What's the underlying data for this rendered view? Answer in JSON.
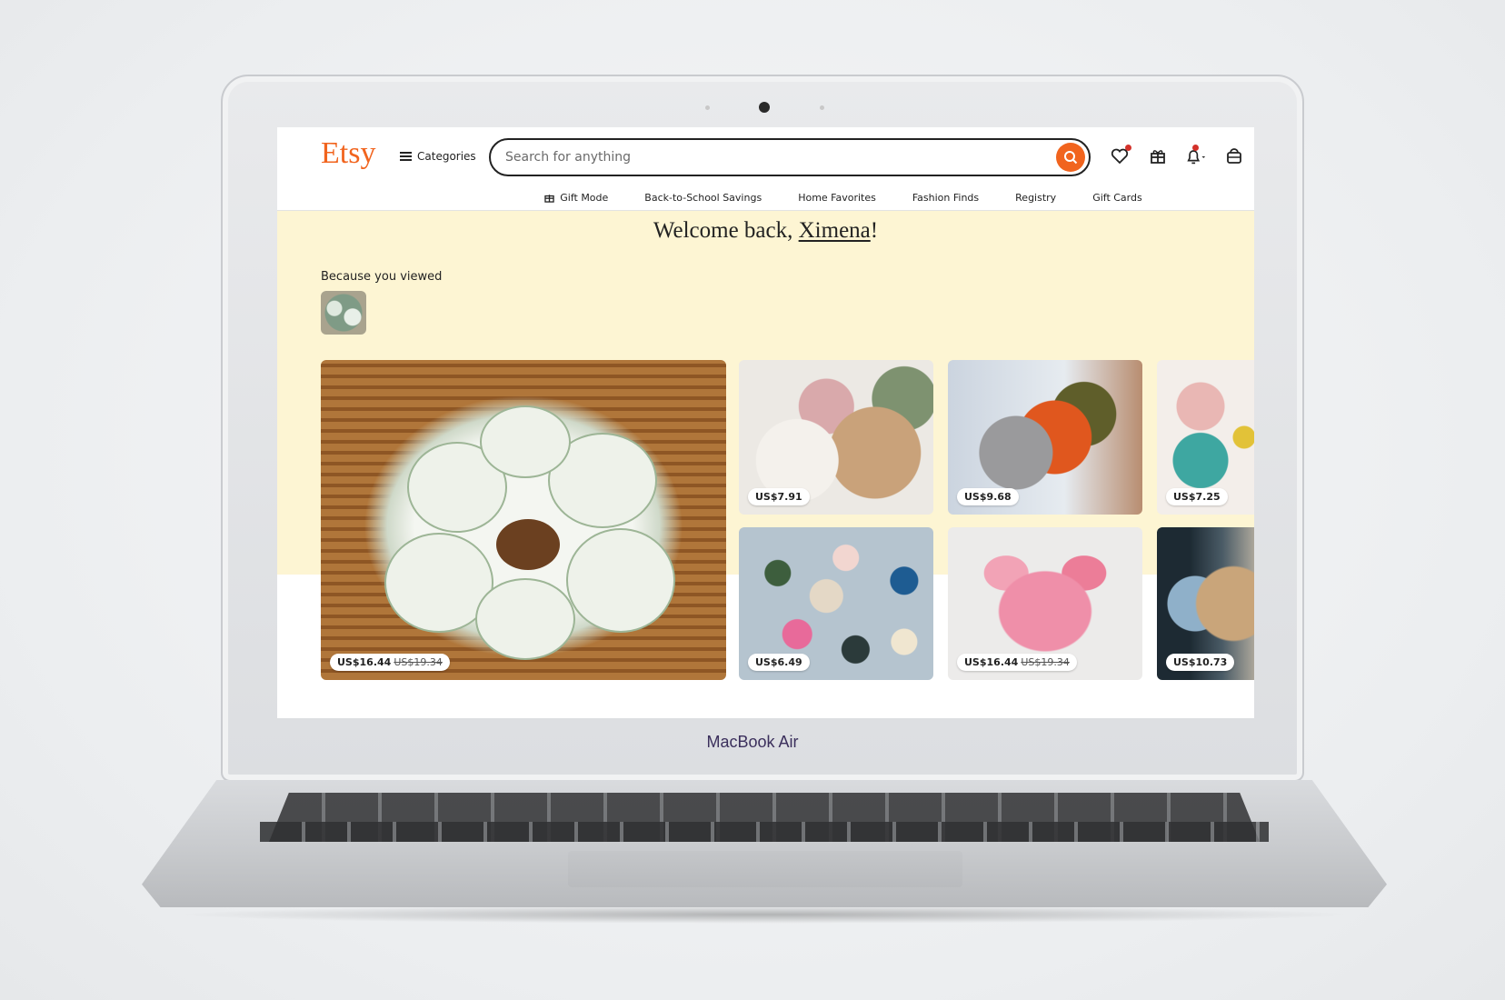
{
  "device": {
    "label": "MacBook Air"
  },
  "header": {
    "logo": "Etsy",
    "categories_label": "Categories",
    "search_placeholder": "Search for anything"
  },
  "subnav": {
    "items": [
      "Gift Mode",
      "Back-to-School Savings",
      "Home Favorites",
      "Fashion Finds",
      "Registry",
      "Gift Cards"
    ]
  },
  "banner": {
    "welcome_prefix": "Welcome back, ",
    "user_name": "Ximena",
    "welcome_suffix": "!",
    "because_viewed": "Because you viewed"
  },
  "listings": [
    {
      "price": "US$16.44",
      "original_price": "US$19.34"
    },
    {
      "price": "US$7.91",
      "original_price": ""
    },
    {
      "price": "US$9.68",
      "original_price": ""
    },
    {
      "price": "US$7.25",
      "original_price": ""
    },
    {
      "price": "US$6.49",
      "original_price": ""
    },
    {
      "price": "US$16.44",
      "original_price": "US$19.34"
    },
    {
      "price": "US$10.73",
      "original_price": ""
    }
  ],
  "colors": {
    "brand": "#f1641e",
    "banner": "#fdf5d3",
    "badge": "#d3312a"
  },
  "icons": [
    "hamburger-icon",
    "search-icon",
    "heart-icon",
    "gift-icon",
    "bell-icon",
    "cart-icon"
  ]
}
